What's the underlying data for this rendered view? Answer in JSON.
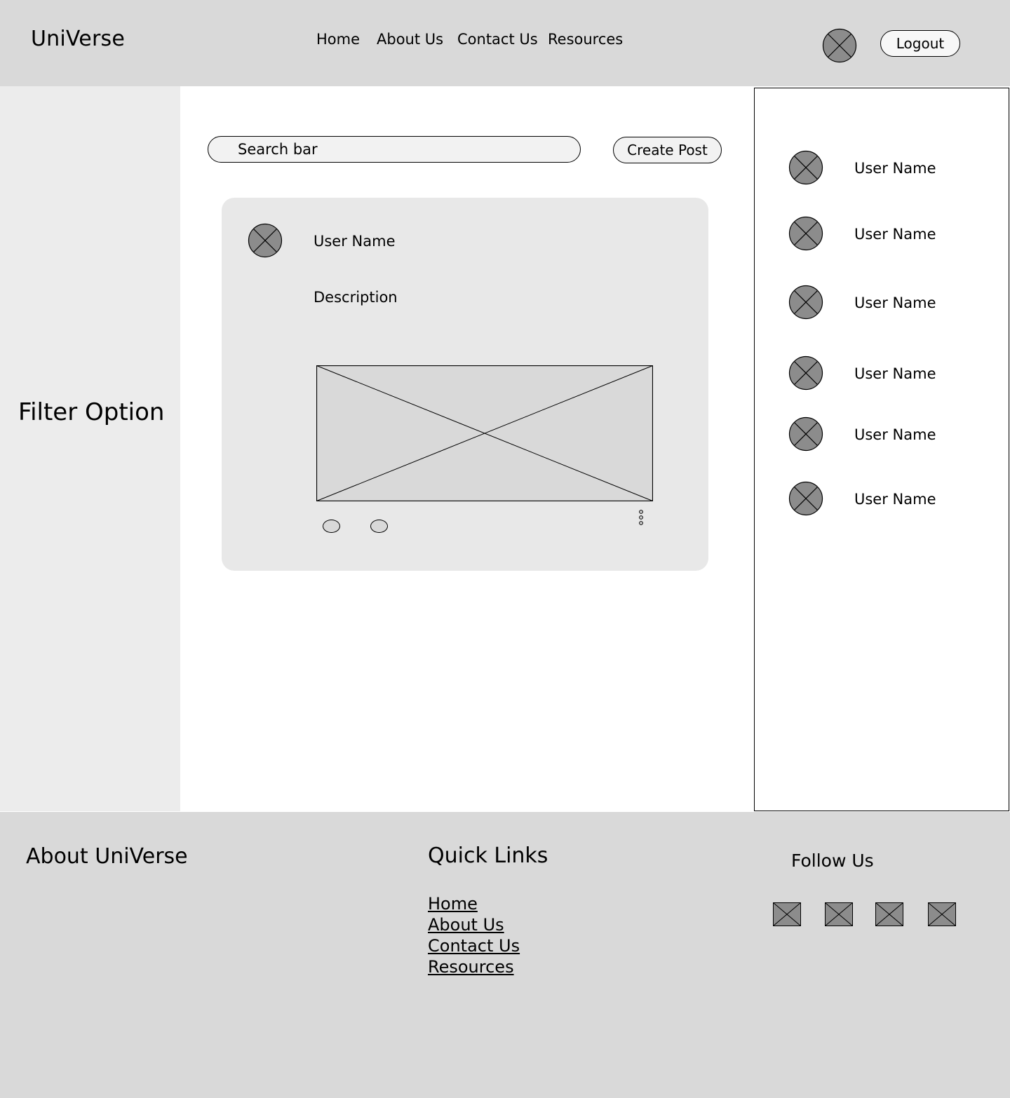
{
  "header": {
    "brand": "UniVerse",
    "nav": [
      "Home",
      "About Us",
      "Contact Us",
      "Resources"
    ],
    "logout_label": "Logout"
  },
  "filter": {
    "label": "Filter Option"
  },
  "search": {
    "placeholder": "Search bar"
  },
  "create_post_label": "Create Post",
  "post": {
    "user_name": "User Name",
    "description": "Description"
  },
  "users": [
    {
      "name": "User Name"
    },
    {
      "name": "User Name"
    },
    {
      "name": "User Name"
    },
    {
      "name": "User Name"
    },
    {
      "name": "User Name"
    },
    {
      "name": "User Name"
    }
  ],
  "footer": {
    "about_title": "About UniVerse",
    "quick_links_title": "Quick Links",
    "quick_links": [
      "Home",
      "About Us",
      "Contact Us",
      "Resources"
    ],
    "follow_title": "Follow Us",
    "social_icons": [
      "social-icon-placeholder",
      "social-icon-placeholder",
      "social-icon-placeholder",
      "social-icon-placeholder"
    ]
  },
  "colors": {
    "header_bg": "#d9d9d9",
    "filter_bg": "#ececec",
    "card_bg": "#e8e8e8",
    "avatar_fill": "#8c8c8c",
    "image_placeholder": "#d9d9d9"
  }
}
